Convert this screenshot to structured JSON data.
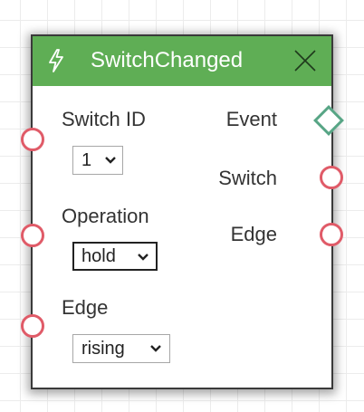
{
  "node": {
    "title": "SwitchChanged",
    "header_color": "#5fae55",
    "icon": "lightning-bolt-icon",
    "close_icon": "close-icon",
    "inputs": [
      {
        "label": "Switch ID",
        "value": "1"
      },
      {
        "label": "Operation",
        "value": "hold"
      },
      {
        "label": "Edge",
        "value": "rising"
      }
    ],
    "outputs": [
      {
        "label": "Event"
      },
      {
        "label": "Switch"
      },
      {
        "label": "Edge"
      }
    ],
    "colors": {
      "data_port": "#e05b68",
      "event_port": "#57a585"
    }
  }
}
